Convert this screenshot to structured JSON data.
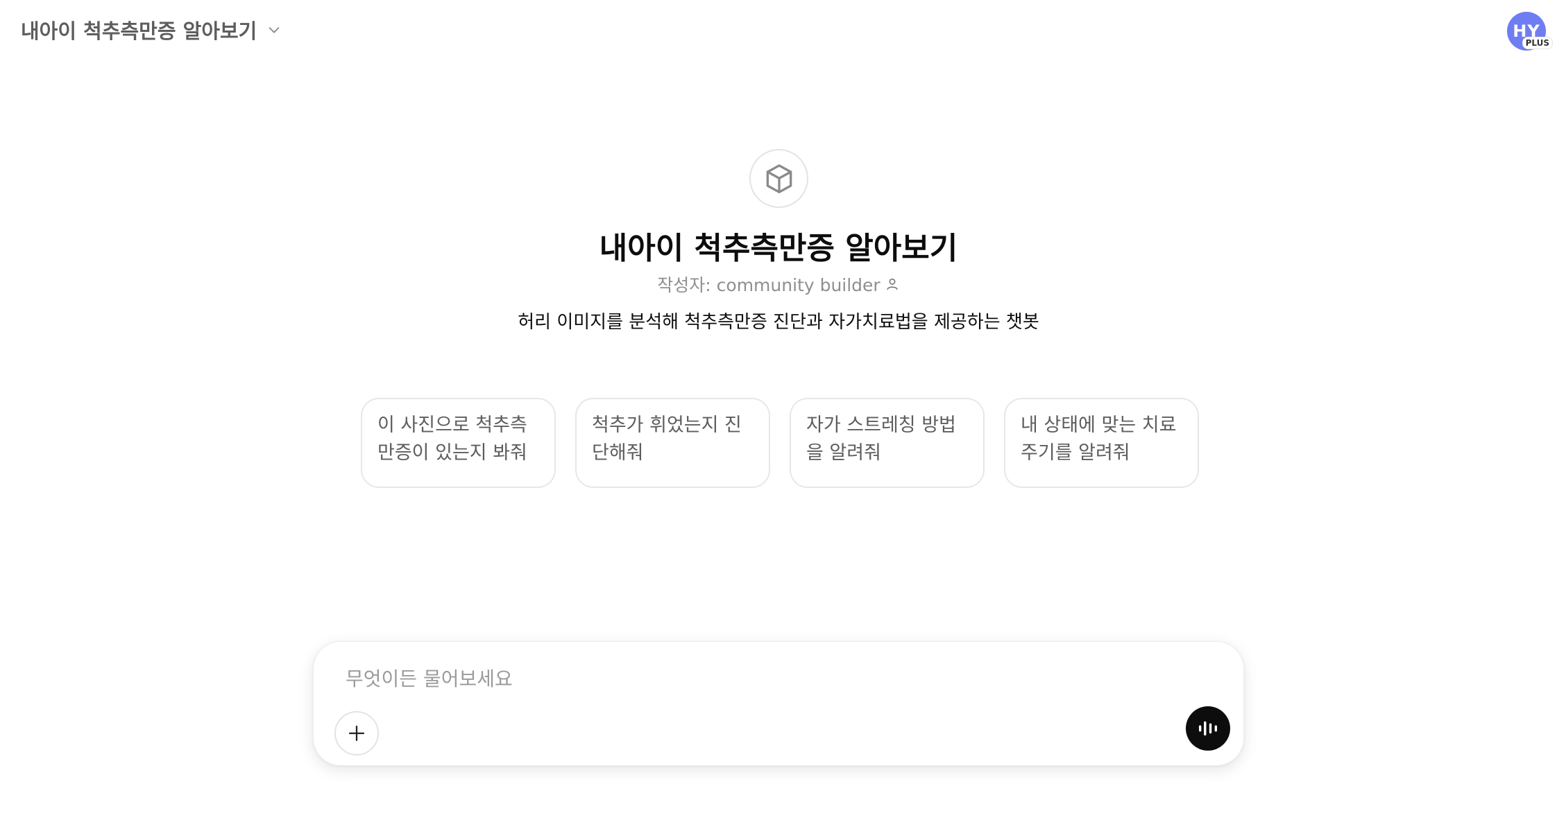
{
  "header": {
    "gpt_name": "내아이 척추측만증 알아보기",
    "avatar_initials": "HY",
    "avatar_badge": "PLUS",
    "avatar_color": "#6f7df2"
  },
  "hero": {
    "icon": "cube-icon",
    "title": "내아이 척추측만증 알아보기",
    "author": "작성자: community builder",
    "author_icon": "person-icon",
    "description": "허리 이미지를 분석해 척추측만증 진단과 자가치료법을 제공하는 챗봇"
  },
  "starters": [
    {
      "label": "이 사진으로 척추측만증이 있는지 봐줘"
    },
    {
      "label": "척추가 휘었는지 진단해줘"
    },
    {
      "label": "자가 스트레칭 방법을 알려줘"
    },
    {
      "label": "내 상태에 맞는 치료 주기를 알려줘"
    }
  ],
  "composer": {
    "placeholder": "무엇이든 물어보세요",
    "value": "",
    "add_icon": "plus-icon",
    "voice_icon": "voice-waveform-icon"
  }
}
